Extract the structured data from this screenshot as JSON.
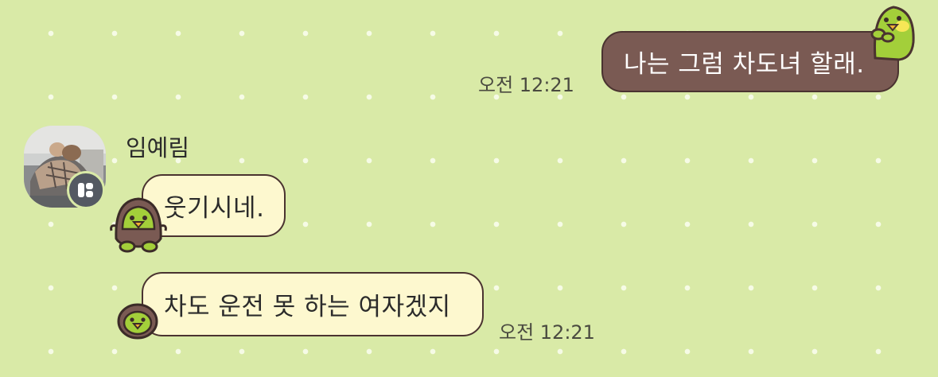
{
  "messages": [
    {
      "direction": "outgoing",
      "text": "나는 그럼 차도녀 할래.",
      "time": "오전 12:21"
    },
    {
      "direction": "incoming",
      "sender": "임예림",
      "text": "웃기시네."
    },
    {
      "direction": "incoming",
      "text": "차도 운전 못 하는 여자겠지",
      "time": "오전 12:21"
    }
  ],
  "colors": {
    "background": "#d9eaa7",
    "outgoing_bubble": "#7a5a53",
    "incoming_bubble": "#fdf8cf",
    "bubble_border": "#4a3330"
  },
  "icons": {
    "bubble_decoration": "green-bird-mascot-icon",
    "profile_badge": "chat-badge-icon"
  }
}
